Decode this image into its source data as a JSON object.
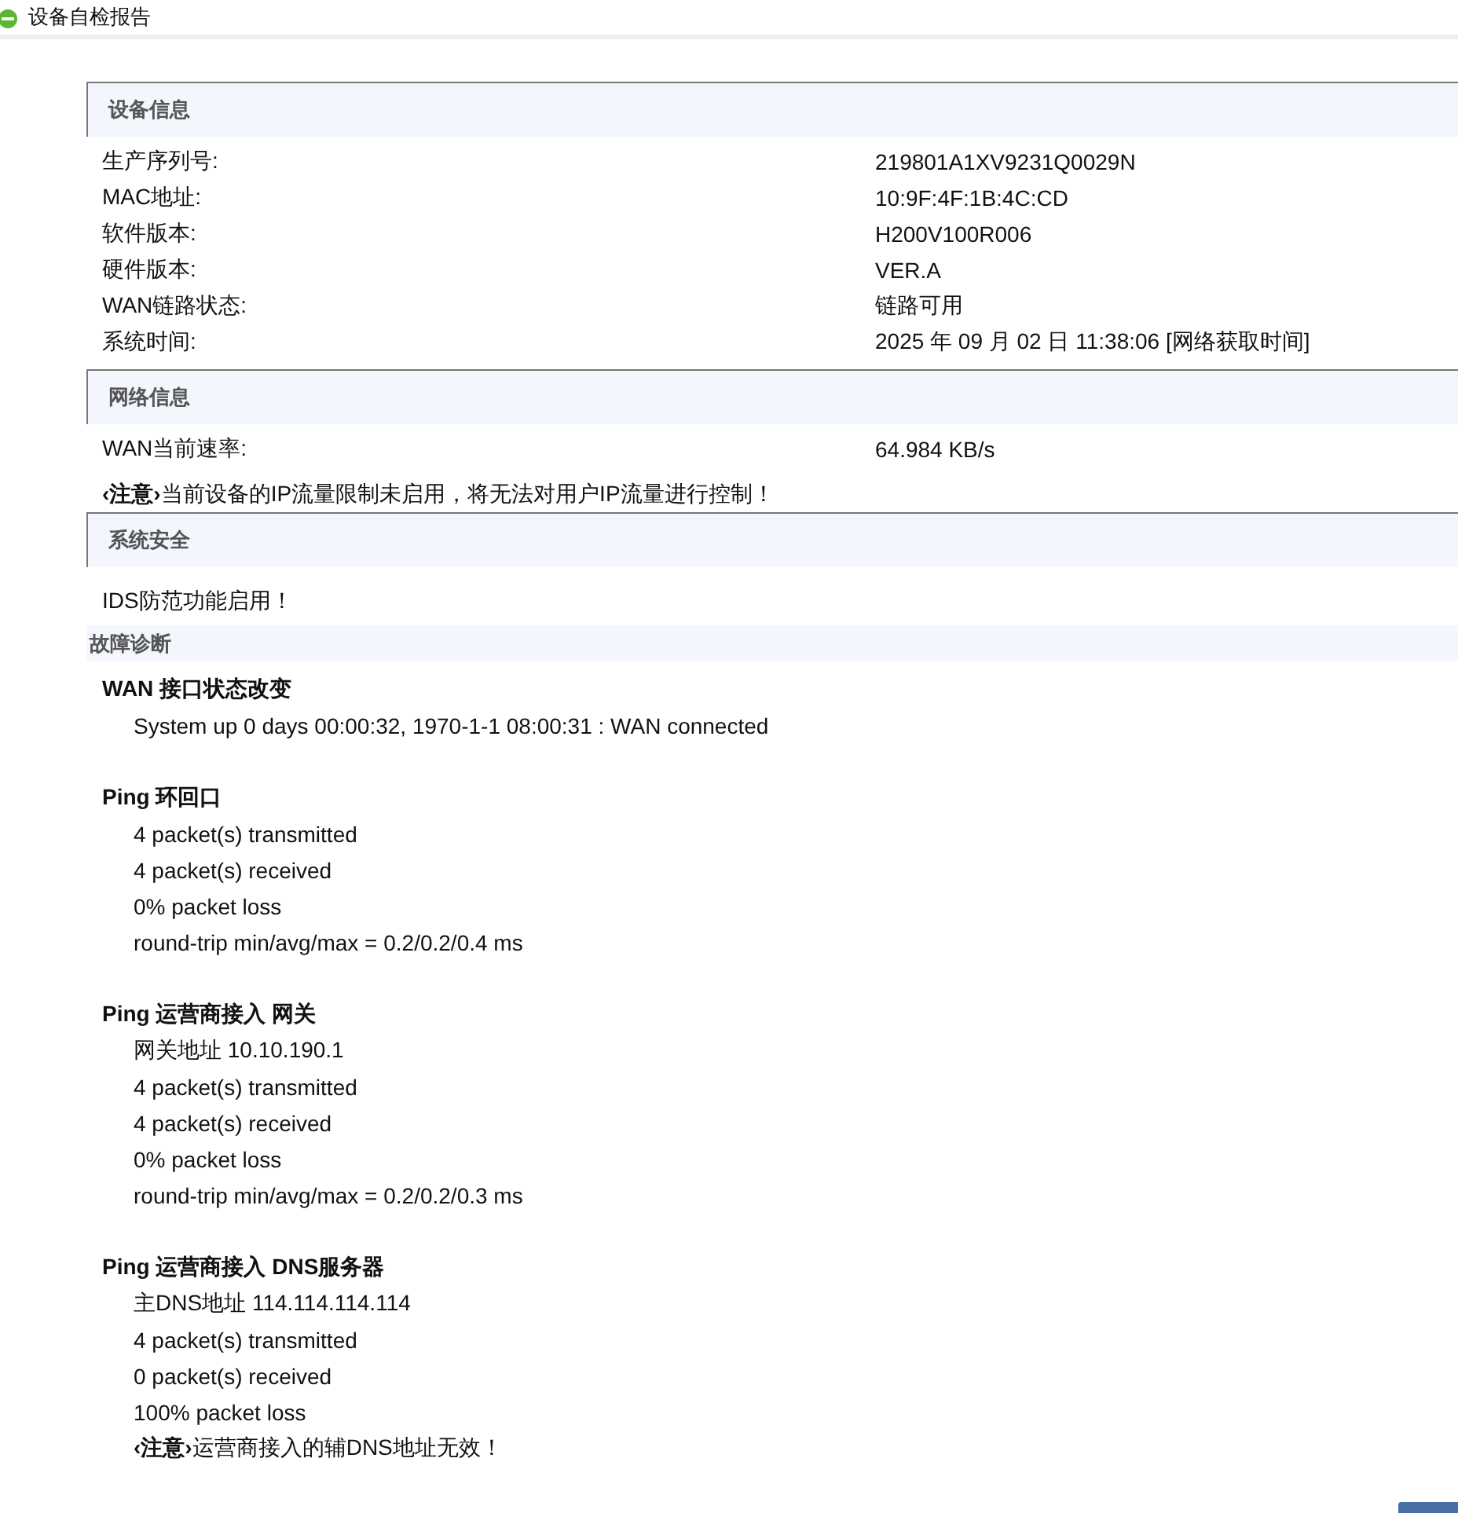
{
  "window": {
    "title": "设备自检报告"
  },
  "sections": [
    {
      "title": "设备信息",
      "rows": [
        {
          "label": "生产序列号:",
          "value": "219801A1XV9231Q0029N"
        },
        {
          "label": "MAC地址:",
          "value": "10:9F:4F:1B:4C:CD"
        },
        {
          "label": "软件版本:",
          "value": "H200V100R006"
        },
        {
          "label": "硬件版本:",
          "value": "VER.A"
        },
        {
          "label": "WAN链路状态:",
          "value": "链路可用"
        },
        {
          "label": "系统时间:",
          "value": "2025 年 09 月 02 日 11:38:06 [网络获取时间]"
        }
      ]
    },
    {
      "title": "网络信息",
      "rows": [
        {
          "label": "WAN当前速率:",
          "value": "64.984 KB/s"
        }
      ],
      "notes": [
        "**‹注意›**当前设备的IP流量限制未启用，将无法对用户IP流量进行控制！"
      ]
    },
    {
      "title": "系统安全",
      "notes": [
        "IDS防范功能启用！"
      ]
    }
  ],
  "diagnosis": {
    "title": "故障诊断",
    "groups": [
      {
        "title": "WAN 接口状态改变",
        "lines": [
          "System up 0 days 00:00:32, 1970-1-1 08:00:31 : WAN connected"
        ]
      },
      {
        "title": "Ping 环回口",
        "lines": [
          "4 packet(s) transmitted",
          "4 packet(s) received",
          "0% packet loss",
          "round-trip min/avg/max = 0.2/0.2/0.4 ms"
        ]
      },
      {
        "title": "Ping 运营商接入 网关",
        "lines": [
          "网关地址 10.10.190.1",
          "4 packet(s) transmitted",
          "4 packet(s) received",
          "0% packet loss",
          "round-trip min/avg/max = 0.2/0.2/0.3 ms"
        ]
      },
      {
        "title": "Ping 运营商接入 DNS服务器",
        "lines": [
          "主DNS地址 114.114.114.114",
          "4 packet(s) transmitted",
          "0 packet(s) received",
          "100% packet loss",
          "**‹注意›**运营商接入的辅DNS地址无效！"
        ]
      }
    ]
  }
}
